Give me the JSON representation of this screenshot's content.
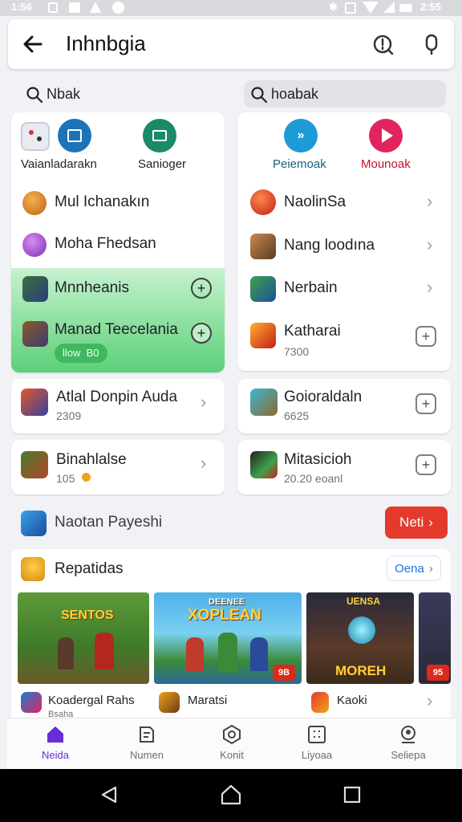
{
  "status_bar": {
    "left_time": "1:56",
    "right_time": "2:55"
  },
  "header": {
    "title": "Inhnbgia"
  },
  "search": {
    "left_query": "Nbak",
    "right_query": "hoabak"
  },
  "left_panel": {
    "top_apps": [
      {
        "label": "Vaianladarakn"
      },
      {
        "label": "Sanioger"
      }
    ],
    "rows": [
      {
        "title": "Mul Ichanakın"
      },
      {
        "title": "Moha Fhedsan"
      },
      {
        "title": "Mnnheanis"
      },
      {
        "title": "Manad Teecelania",
        "badge": "llow  B0"
      }
    ]
  },
  "right_panel": {
    "top_apps": [
      {
        "label": "Peiemoak"
      },
      {
        "label": "Mounoak"
      }
    ],
    "rows": [
      {
        "title": "NaolinSa"
      },
      {
        "title": "Nang loodına"
      },
      {
        "title": "Nerbain"
      },
      {
        "title": "Katharai",
        "sub": "7300"
      }
    ]
  },
  "left_cards": [
    {
      "title": "Atlal Donpin Auda",
      "sub": "2309"
    },
    {
      "title": "Binahlalse",
      "sub": "105"
    }
  ],
  "right_cards": [
    {
      "title": "Goioraldaln",
      "sub": "6625"
    },
    {
      "title": "Mitasicioh",
      "sub": "20.20 eoanl"
    }
  ],
  "promo": {
    "title": "Naotan Payeshi",
    "button": "Neti"
  },
  "featured": {
    "title": "Repatidas",
    "see_all": "Oena",
    "games": [
      {
        "art_title": "SENTOS",
        "name": "Koadergal Rahs",
        "sub": "Bsaha"
      },
      {
        "art_title": "XOPLEAN",
        "art_top": "DEENEE",
        "name": "Maratsi",
        "badge": "9B"
      },
      {
        "art_title": "MOREH",
        "art_top": "UENSA",
        "name": "Kaoki"
      },
      {
        "art_title": "",
        "badge": "95"
      }
    ]
  },
  "tabs": [
    {
      "label": "Neida",
      "active": true
    },
    {
      "label": "Numen"
    },
    {
      "label": "Konit"
    },
    {
      "label": "Liyoaa"
    },
    {
      "label": "Seliepa"
    }
  ],
  "colors": {
    "accent": "#6a2bd8",
    "promo_red": "#e33a2c",
    "green_highlight": "#59d27a",
    "see_all_blue": "#1a73e8"
  }
}
